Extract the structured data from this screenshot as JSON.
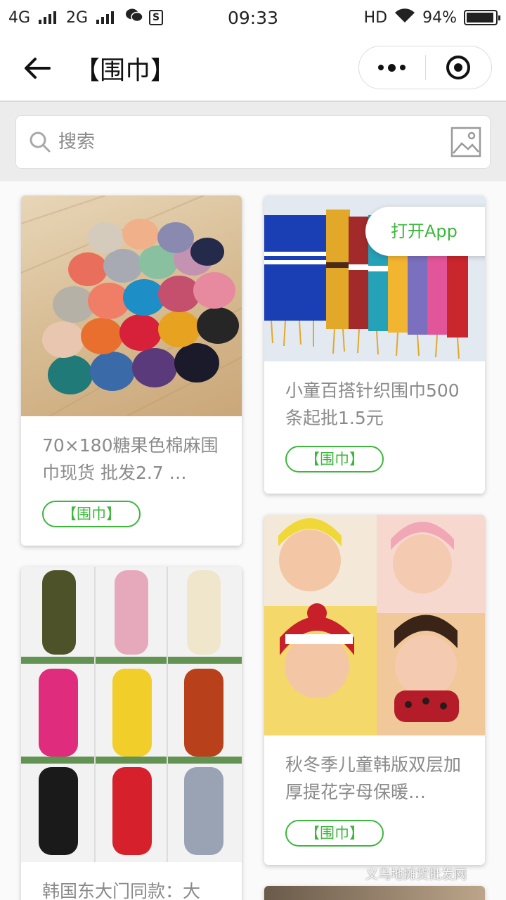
{
  "status_bar": {
    "network_left": "4G",
    "network_right": "2G",
    "time": "09:33",
    "hd": "HD",
    "battery": "94%",
    "battery_level": 0.94
  },
  "nav": {
    "title": "【围巾】"
  },
  "search": {
    "placeholder": "搜索"
  },
  "open_app": "打开App",
  "products": [
    {
      "title": "70×180糖果色棉麻围巾现货 批发2.7 …",
      "tag": "【围巾】"
    },
    {
      "title": "小童百搭针织围巾500条起批1.5元",
      "tag": "【围巾】"
    },
    {
      "title": "秋冬季儿童韩版双层加厚提花字母保暖…",
      "tag": "【围巾】"
    },
    {
      "title": "韩国东大门同款：大",
      "tag": ""
    }
  ],
  "watermark": "义乌地摊货批发网"
}
